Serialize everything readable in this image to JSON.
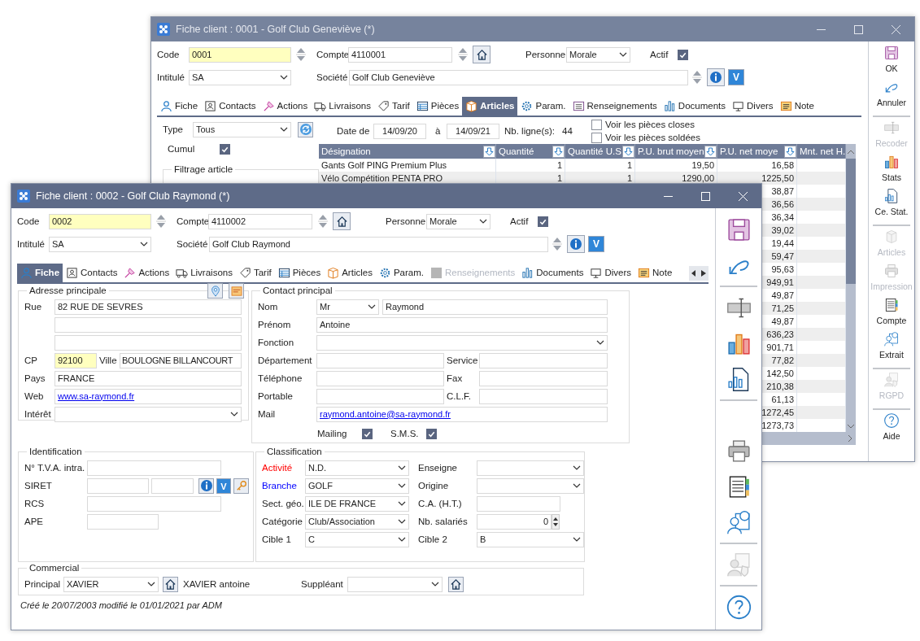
{
  "windows": [
    {
      "title": "Fiche client : 0001 - Golf Club Geneviève (*)",
      "active": false,
      "header": {
        "code": {
          "label": "Code",
          "value": "0001"
        },
        "compte": {
          "label": "Compte",
          "value": "4110001"
        },
        "personne": {
          "label": "Personne",
          "value": "Morale"
        },
        "actif": {
          "label": "Actif",
          "checked": true
        },
        "intitule": {
          "label": "Intitulé",
          "value": "SA"
        },
        "societe": {
          "label": "Société",
          "value": "Golf Club Geneviève"
        },
        "v_button": "V"
      },
      "tabs": [
        {
          "label": "Fiche",
          "selected": false,
          "disabled": false
        },
        {
          "label": "Contacts",
          "selected": false,
          "disabled": false
        },
        {
          "label": "Actions",
          "selected": false,
          "disabled": false
        },
        {
          "label": "Livraisons",
          "selected": false,
          "disabled": false
        },
        {
          "label": "Tarif",
          "selected": false,
          "disabled": false
        },
        {
          "label": "Pièces",
          "selected": false,
          "disabled": false
        },
        {
          "label": "Articles",
          "selected": true,
          "disabled": false
        },
        {
          "label": "Param.",
          "selected": false,
          "disabled": false
        },
        {
          "label": "Renseignements",
          "selected": false,
          "disabled": false
        },
        {
          "label": "Documents",
          "selected": false,
          "disabled": false
        },
        {
          "label": "Divers",
          "selected": false,
          "disabled": false
        },
        {
          "label": "Note",
          "selected": false,
          "disabled": false
        }
      ],
      "articles_panel": {
        "type": {
          "label": "Type",
          "value": "Tous"
        },
        "date_from": {
          "label": "Date de",
          "value": "14/09/20"
        },
        "date_to": {
          "label": "à",
          "value": "14/09/21"
        },
        "line_count": {
          "label": "Nb. ligne(s):",
          "value": "44"
        },
        "options": [
          {
            "label": "Voir les pièces closes",
            "checked": false
          },
          {
            "label": "Voir les pièces soldées",
            "checked": false
          }
        ],
        "cumul": {
          "label": "Cumul",
          "checked": true
        },
        "filter_group": "Filtrage article",
        "table": {
          "columns": [
            "Désignation",
            "Quantité",
            "Quantité U.S",
            "P.U. brut moyen",
            "P.U. net moye",
            "Mnt. net H."
          ],
          "rows": [
            {
              "designation": "Gants Golf PING Premium Plus",
              "quantite": "1",
              "quantite_us": "1",
              "pu_brut": "19,50",
              "pu_net": "16,58"
            },
            {
              "designation": "Vélo Compétition PENTA PRO",
              "quantite": "1",
              "quantite_us": "1",
              "pu_brut": "1290,00",
              "pu_net": "1225,50"
            },
            {
              "pu_net": "38,87"
            },
            {
              "pu_net": "36,56"
            },
            {
              "pu_net": "36,34"
            },
            {
              "pu_net": "39,02"
            },
            {
              "pu_net": "19,44"
            },
            {
              "pu_net": "59,47"
            },
            {
              "pu_net": "95,63"
            },
            {
              "pu_net": "949,91"
            },
            {
              "pu_net": "49,87"
            },
            {
              "pu_net": "71,25"
            },
            {
              "pu_net": "49,87"
            },
            {
              "pu_net": "636,23"
            },
            {
              "pu_net": "901,71"
            },
            {
              "pu_net": "77,82"
            },
            {
              "pu_net": "142,50"
            },
            {
              "pu_net": "210,38"
            },
            {
              "pu_net": "61,13"
            },
            {
              "pu_net": "1272,45"
            },
            {
              "pu_net": "1273,73"
            }
          ]
        }
      },
      "toolbar": [
        {
          "kind": "save",
          "label": "OK",
          "disabled": false
        },
        {
          "kind": "undo",
          "label": "Annuler",
          "disabled": false
        },
        {
          "kind": "separator"
        },
        {
          "kind": "recode",
          "label": "Recoder",
          "disabled": true
        },
        {
          "kind": "stats",
          "label": "Stats",
          "disabled": false
        },
        {
          "kind": "report",
          "label": "Ce. Stat.",
          "disabled": false
        },
        {
          "kind": "separator"
        },
        {
          "kind": "articles",
          "label": "Articles",
          "disabled": true
        },
        {
          "kind": "print",
          "label": "Impression",
          "disabled": true
        },
        {
          "kind": "account",
          "label": "Compte",
          "disabled": false
        },
        {
          "kind": "extract",
          "label": "Extrait",
          "disabled": false
        },
        {
          "kind": "separator"
        },
        {
          "kind": "gdpr",
          "label": "RGPD",
          "disabled": true
        },
        {
          "kind": "separator"
        },
        {
          "kind": "help",
          "label": "Aide",
          "disabled": false
        }
      ]
    },
    {
      "title": "Fiche client : 0002 - Golf Club Raymond (*)",
      "active": true,
      "header": {
        "code": {
          "label": "Code",
          "value": "0002"
        },
        "compte": {
          "label": "Compte",
          "value": "4110002"
        },
        "personne": {
          "label": "Personne",
          "value": "Morale"
        },
        "actif": {
          "label": "Actif",
          "checked": true
        },
        "intitule": {
          "label": "Intitulé",
          "value": "SA"
        },
        "societe": {
          "label": "Société",
          "value": "Golf Club Raymond"
        },
        "v_button": "V"
      },
      "tabs": [
        {
          "label": "Fiche",
          "selected": true,
          "disabled": false
        },
        {
          "label": "Contacts",
          "selected": false,
          "disabled": false
        },
        {
          "label": "Actions",
          "selected": false,
          "disabled": false
        },
        {
          "label": "Livraisons",
          "selected": false,
          "disabled": false
        },
        {
          "label": "Tarif",
          "selected": false,
          "disabled": false
        },
        {
          "label": "Pièces",
          "selected": false,
          "disabled": false
        },
        {
          "label": "Articles",
          "selected": false,
          "disabled": false
        },
        {
          "label": "Param.",
          "selected": false,
          "disabled": false
        },
        {
          "label": "Renseignements",
          "selected": false,
          "disabled": true
        },
        {
          "label": "Documents",
          "selected": false,
          "disabled": false
        },
        {
          "label": "Divers",
          "selected": false,
          "disabled": false
        },
        {
          "label": "Note",
          "selected": false,
          "disabled": false
        }
      ],
      "fiche": {
        "address": {
          "title": "Adresse principale",
          "street": {
            "label": "Rue",
            "value": "82 RUE DE SEVRES"
          },
          "cp": {
            "label": "CP",
            "value": "92100"
          },
          "ville": {
            "label": "Ville",
            "value": "BOULOGNE BILLANCOURT"
          },
          "pays": {
            "label": "Pays",
            "value": "FRANCE"
          },
          "web": {
            "label": "Web",
            "value": "www.sa-raymond.fr"
          },
          "interet": {
            "label": "Intérêt"
          }
        },
        "contact": {
          "title": "Contact principal",
          "nom": {
            "label": "Nom",
            "civility": "Mr",
            "value": "Raymond"
          },
          "prenom": {
            "label": "Prénom",
            "value": "Antoine"
          },
          "fonction": {
            "label": "Fonction"
          },
          "departement": {
            "label": "Département"
          },
          "service": {
            "label": "Service"
          },
          "telephone": {
            "label": "Téléphone"
          },
          "fax": {
            "label": "Fax"
          },
          "portable": {
            "label": "Portable"
          },
          "clf": {
            "label": "C.L.F."
          },
          "mail": {
            "label": "Mail",
            "value": "raymond.antoine@sa-raymond.fr"
          },
          "mailing": {
            "label": "Mailing",
            "checked": true
          },
          "sms": {
            "label": "S.M.S.",
            "checked": true
          }
        },
        "identification": {
          "title": "Identification",
          "tva": {
            "label": "N° T.V.A. intra."
          },
          "siret": {
            "label": "SIRET"
          },
          "rcs": {
            "label": "RCS"
          },
          "ape": {
            "label": "APE"
          },
          "v_button": "V"
        },
        "classification": {
          "title": "Classification",
          "items": [
            {
              "label": "Activité",
              "value": "N.D.",
              "kind": "select",
              "color": "#ff0000"
            },
            {
              "label": "Enseigne",
              "kind": "select",
              "color": "#222222"
            },
            {
              "label": "Branche",
              "value": "GOLF",
              "kind": "select",
              "color": "#0000ff"
            },
            {
              "label": "Origine",
              "kind": "select",
              "color": "#222222"
            },
            {
              "label": "Sect. géo.",
              "value": "ILE DE FRANCE",
              "kind": "select",
              "color": "#222222"
            },
            {
              "label": "C.A. (H.T.)",
              "kind": "text",
              "color": "#222222"
            },
            {
              "label": "Catégorie",
              "value": "Club/Association",
              "kind": "select",
              "color": "#222222"
            },
            {
              "label": "Nb. salariés",
              "value": "0",
              "kind": "number",
              "color": "#222222"
            },
            {
              "label": "Cible 1",
              "value": "C",
              "kind": "select",
              "color": "#222222"
            },
            {
              "label": "Cible 2",
              "value": "B",
              "kind": "select",
              "color": "#222222"
            }
          ]
        },
        "commercial": {
          "title": "Commercial",
          "principal": {
            "label": "Principal",
            "value": "XAVIER",
            "name": "XAVIER antoine"
          },
          "suppleant": {
            "label": "Suppléant"
          }
        },
        "footer": "Créé le 20/07/2003 modifié le 01/01/2021 par ADM"
      },
      "toolbar": [
        {
          "kind": "save",
          "disabled": false
        },
        {
          "kind": "undo",
          "disabled": false
        },
        {
          "kind": "separator"
        },
        {
          "kind": "recode",
          "disabled": false
        },
        {
          "kind": "stats",
          "disabled": false
        },
        {
          "kind": "report",
          "disabled": false
        },
        {
          "kind": "separator"
        },
        {
          "kind": "gap"
        },
        {
          "kind": "print",
          "disabled": false
        },
        {
          "kind": "account",
          "disabled": false
        },
        {
          "kind": "extract",
          "disabled": false
        },
        {
          "kind": "separator"
        },
        {
          "kind": "gdpr",
          "disabled": true
        },
        {
          "kind": "separator"
        },
        {
          "kind": "help",
          "disabled": false
        }
      ]
    }
  ]
}
